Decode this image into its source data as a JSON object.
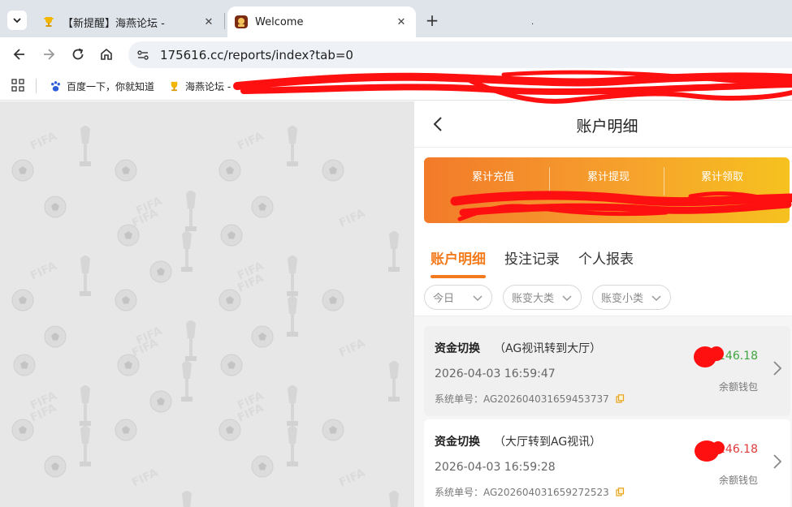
{
  "browser": {
    "tabs": [
      {
        "title": "【新提醒】海燕论坛 -",
        "close": "✕",
        "icon": "trophy-icon"
      },
      {
        "title": "Welcome",
        "close": "✕",
        "icon": "site-logo-icon"
      }
    ],
    "new_tab": "+",
    "tab_strip_dot": ".",
    "url": "175616.cc/reports/index?tab=0"
  },
  "bookmarks": [
    {
      "label": "百度一下，你就知道",
      "icon": "baidu-paw-icon"
    },
    {
      "label": "海燕论坛 -",
      "icon": "trophy-icon"
    }
  ],
  "page": {
    "title": "账户明细",
    "stats": [
      {
        "label": "累计充值"
      },
      {
        "label": "累计提现"
      },
      {
        "label": "累计领取"
      }
    ],
    "tabs": [
      "账户明细",
      "投注记录",
      "个人报表"
    ],
    "active_tab": 0,
    "filters": [
      {
        "value": "今日"
      },
      {
        "value": "账变大类"
      },
      {
        "value": "账变小类"
      }
    ],
    "records": [
      {
        "type": "资金切换",
        "desc": "（AG视讯转到大厅）",
        "time": "2026-04-03 16:59:47",
        "order": "系统单号：AG202604031659453737",
        "amount": "146.18",
        "amount_color": "#3fa53f",
        "wallet": "余额钱包"
      },
      {
        "type": "资金切换",
        "desc": "（大厅转到AG视讯）",
        "time": "2026-04-03 16:59:28",
        "order": "系统单号：AG202604031659272523",
        "amount": "146.18",
        "amount_color": "#e03b3b",
        "wallet": "余额钱包"
      }
    ]
  },
  "colors": {
    "accent": "#f37b1d",
    "redaction": "#ff1010"
  }
}
